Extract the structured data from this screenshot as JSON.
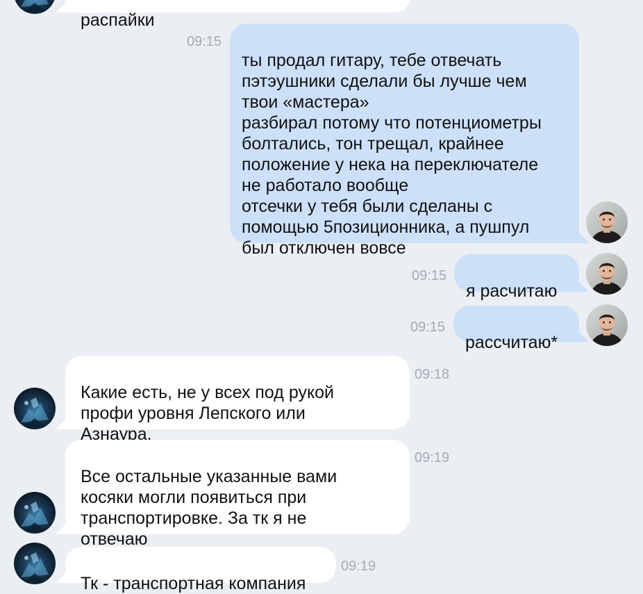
{
  "messages": [
    {
      "id": "m0",
      "text": "распайки",
      "time": ""
    },
    {
      "id": "m1",
      "text": "ты продал гитару, тебе отвечать\nпэтэушники сделали бы лучше чем\nтвои «мастера»\nразбирал потому что потенциометры\nболтались, тон трещал, крайнее\nположение у нека на переключателе\nне работало вообще\nотсечки у тебя были сделаны с\nпомощью 5позиционника, а пушпул\nбыл отключен вовсе",
      "time": "09:15"
    },
    {
      "id": "m2",
      "text": "я расчитаю",
      "time": "09:15"
    },
    {
      "id": "m3",
      "text": "рассчитаю*",
      "time": "09:15"
    },
    {
      "id": "m4",
      "text": "Какие есть, не у всех под рукой\nпрофи уровня Лепского или\nАзнаура.",
      "time": "09:18"
    },
    {
      "id": "m5",
      "text": "Все остальные указанные вами\nкосяки могли появиться при\nтранспортировке. За тк я не\nотвечаю",
      "time": "09:19"
    },
    {
      "id": "m6",
      "text": "Тк - транспортная компания",
      "time": "09:19"
    }
  ],
  "avatars": {
    "self": "user-face-avatar",
    "other": "dark-blue-art-avatar"
  },
  "colors": {
    "background": "#ebeef3",
    "incoming_bubble": "#ffffff",
    "outgoing_bubble": "#cde0f9",
    "timestamp": "#a4abb5"
  }
}
